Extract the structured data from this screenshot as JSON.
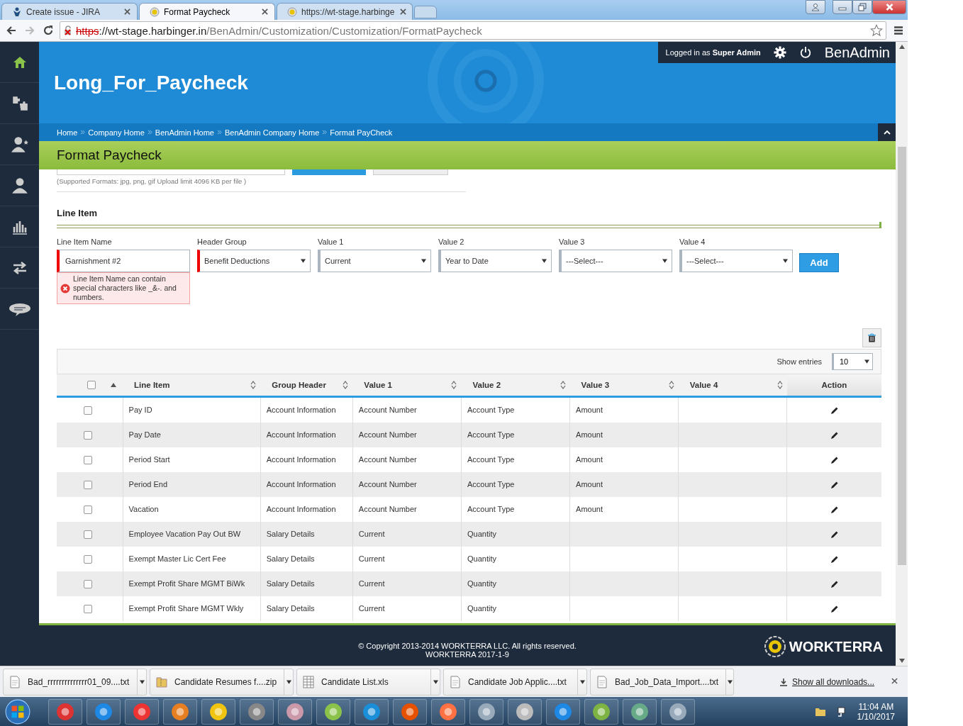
{
  "browser": {
    "tabs": [
      {
        "title": "Create issue - JIRA",
        "kind": "jira",
        "selected": false
      },
      {
        "title": "Format Paycheck",
        "kind": "site",
        "selected": true
      },
      {
        "title": "https://wt-stage.harbinge",
        "kind": "site",
        "selected": false
      }
    ],
    "address": {
      "scheme": "https",
      "host": "://wt-stage.harbinger.in",
      "path": "/BenAdmin/Customization/Customization/FormatPaycheck"
    }
  },
  "header": {
    "title": "Long_For_Paycheck",
    "login_prefix": "Logged in as",
    "user": "Super Admin",
    "app": "BenAdmin"
  },
  "breadcrumbs": [
    "Home",
    "Company Home",
    "BenAdmin Home",
    "BenAdmin Company Home",
    "Format PayCheck"
  ],
  "page_title": "Format Paycheck",
  "upload_note": "(Supported Formats: jpg, png, gif Upload limit 4096 KB per file )",
  "line_item": {
    "heading": "Line Item",
    "fields": [
      {
        "label": "Line Item Name",
        "kind": "text",
        "value": "Garnishment #2",
        "invalid": true
      },
      {
        "label": "Header Group",
        "kind": "select",
        "value": "Benefit Deductions",
        "invalid": true
      },
      {
        "label": "Value 1",
        "kind": "select",
        "value": "Current",
        "invalid": false
      },
      {
        "label": "Value 2",
        "kind": "select",
        "value": "Year to Date",
        "invalid": false
      },
      {
        "label": "Value 3",
        "kind": "select",
        "value": "---Select---",
        "invalid": false
      },
      {
        "label": "Value 4",
        "kind": "select",
        "value": "---Select---",
        "invalid": false
      }
    ],
    "error": "Line Item Name can contain special characters like _&-. and numbers.",
    "add_button": "Add"
  },
  "table": {
    "show_entries_label": "Show entries",
    "page_size": "10",
    "select_all_checked": false,
    "columns": [
      {
        "label": "Line Item",
        "sortable": true,
        "sorted_ascending": true
      },
      {
        "label": "Group Header",
        "sortable": true,
        "sorted_ascending": false
      },
      {
        "label": "Value 1",
        "sortable": true,
        "sorted_ascending": false
      },
      {
        "label": "Value 2",
        "sortable": true,
        "sorted_ascending": false
      },
      {
        "label": "Value 3",
        "sortable": true,
        "sorted_ascending": false
      },
      {
        "label": "Value 4",
        "sortable": true,
        "sorted_ascending": false
      },
      {
        "label": "Action",
        "sortable": false,
        "sorted_ascending": false
      }
    ],
    "rows": [
      {
        "checked": false,
        "line_item": "Pay ID",
        "group_header": "Account Information",
        "value_1": "Account Number",
        "value_2": "Account Type",
        "value_3": "Amount"
      },
      {
        "checked": false,
        "line_item": "Pay Date",
        "group_header": "Account Information",
        "value_1": "Account Number",
        "value_2": "Account Type",
        "value_3": "Amount"
      },
      {
        "checked": false,
        "line_item": "Period Start",
        "group_header": "Account Information",
        "value_1": "Account Number",
        "value_2": "Account Type",
        "value_3": "Amount"
      },
      {
        "checked": false,
        "line_item": "Period End",
        "group_header": "Account Information",
        "value_1": "Account Number",
        "value_2": "Account Type",
        "value_3": "Amount"
      },
      {
        "checked": false,
        "line_item": "Vacation",
        "group_header": "Account Information",
        "value_1": "Account Number",
        "value_2": "Account Type",
        "value_3": "Amount"
      },
      {
        "checked": false,
        "line_item": "Employee Vacation Pay Out BW",
        "group_header": "Salary Details",
        "value_1": "Current",
        "value_2": "Quantity"
      },
      {
        "checked": false,
        "line_item": "Exempt Master Lic Cert Fee",
        "group_header": "Salary Details",
        "value_1": "Current",
        "value_2": "Quantity"
      },
      {
        "checked": false,
        "line_item": "Exempt Profit Share MGMT BiWk",
        "group_header": "Salary Details",
        "value_1": "Current",
        "value_2": "Quantity"
      },
      {
        "checked": false,
        "line_item": "Exempt Profit Share MGMT Wkly",
        "group_header": "Salary Details",
        "value_1": "Current",
        "value_2": "Quantity"
      }
    ]
  },
  "footer": {
    "copyright": "© Copyright 2013-2014 WORKTERRA LLC. All rights reserved.",
    "version": "WORKTERRA 2017-1-9",
    "logo": "WORKTERRA"
  },
  "downloads": {
    "items": [
      {
        "name": "Bad_rrrrrrrrrrrrrr01_09....txt",
        "kind": "text"
      },
      {
        "name": "Candidate Resumes f....zip",
        "kind": "zip"
      },
      {
        "name": "Candidate List.xls",
        "kind": "sheet"
      },
      {
        "name": "Candidate Job Applic....txt",
        "kind": "text"
      },
      {
        "name": "Bad_Job_Data_Import....txt",
        "kind": "text"
      }
    ],
    "show_all": "Show all downloads..."
  },
  "taskbar": {
    "time": "11:04 AM",
    "date": "1/10/2017"
  }
}
